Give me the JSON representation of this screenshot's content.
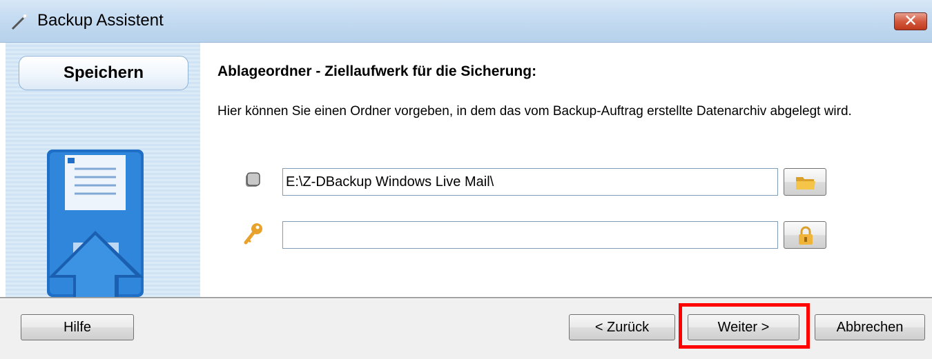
{
  "window": {
    "title": "Backup Assistent",
    "close_label": "✕"
  },
  "sidebar": {
    "step_label": "Speichern"
  },
  "main": {
    "heading": "Ablageordner - Ziellaufwerk für die Sicherung:",
    "description": "Hier können Sie einen Ordner vorgeben, in dem das vom Backup-Auftrag erstellte Datenarchiv abgelegt wird.",
    "path_value": "E:\\Z-DBackup Windows Live Mail\\",
    "password_value": ""
  },
  "footer": {
    "help_label": "Hilfe",
    "back_label": "< Zurück",
    "next_label": "Weiter >",
    "cancel_label": "Abbrechen"
  },
  "colors": {
    "highlight": "#ff0000",
    "close_button": "#c0391c",
    "floppy_blue": "#1f6fc7"
  },
  "icons": {
    "title": "wand-icon",
    "sidebar": "floppy-disk-upload-icon",
    "drive": "drive-icon",
    "password": "key-icon",
    "browse": "folder-icon",
    "encrypt": "lock-icon"
  }
}
